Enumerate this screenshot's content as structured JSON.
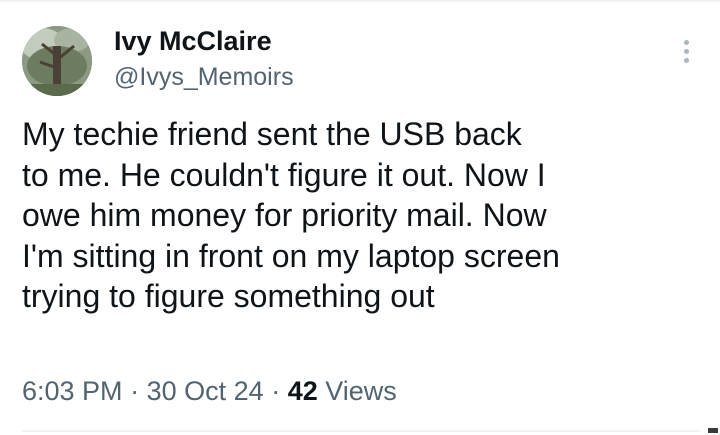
{
  "tweet": {
    "author": {
      "display_name": "Ivy McClaire",
      "handle": "@Ivys_Memoirs",
      "avatar_icon": "avatar-photo-tree"
    },
    "text": "My techie friend sent the USB back\nto me. He couldn't figure it out. Now I\nowe him money for priority mail. Now\nI'm sitting in front on my laptop screen\ntrying to figure something out",
    "time": "6:03 PM",
    "separator": "·",
    "date": "30 Oct 24",
    "views_count": "42",
    "views_label": "Views",
    "more_icon": "more-vertical-icon"
  },
  "colors": {
    "text_primary": "#0f1419",
    "text_secondary": "#536471",
    "divider": "#eff3f4",
    "more_icon": "#aab8c2"
  }
}
